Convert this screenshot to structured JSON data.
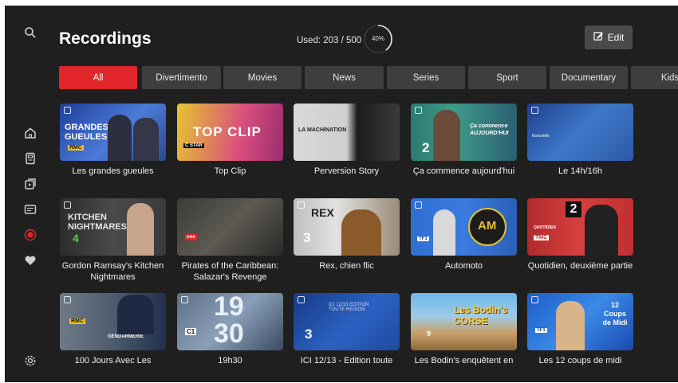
{
  "header": {
    "title": "Recordings",
    "used_text": "Used: 203 / 500",
    "usage_percent": 40,
    "usage_label": "40%",
    "edit_label": "Edit"
  },
  "tabs": [
    "All",
    "Divertimento",
    "Movies",
    "News",
    "Series",
    "Sport",
    "Documentary",
    "Kids"
  ],
  "recordings": [
    {
      "title": "Les grandes gueules",
      "thumb_text": "GRANDES GUEULES",
      "badge": "RMC"
    },
    {
      "title": "Top Clip",
      "thumb_text": "TOP CLIP",
      "badge": "C STAR"
    },
    {
      "title": "Perversion Story",
      "thumb_text": "LA MACHINATION",
      "badge": ""
    },
    {
      "title": "Ça commence aujourd'hui",
      "thumb_text": "Ça commence AUJOURD'HUI",
      "badge": "2"
    },
    {
      "title": "Le 14h/16h",
      "thumb_text": "franceinfo",
      "badge": ""
    },
    {
      "title": "Gordon Ramsay's Kitchen Nightmares",
      "thumb_text": "KITCHEN NIGHTMARES",
      "badge": "4"
    },
    {
      "title": "Pirates of the Caribbean: Salazar's Revenge",
      "thumb_text": "",
      "badge": "one"
    },
    {
      "title": "Rex, chien flic",
      "thumb_text": "REX",
      "badge": "3"
    },
    {
      "title": "Automoto",
      "thumb_text": "AM",
      "badge": "TF1"
    },
    {
      "title": "Quotidien, deuxième partie",
      "thumb_text": "QUOTIDIEN",
      "badge": "TMC"
    },
    {
      "title": "100 Jours Avec Les",
      "thumb_text": "GENDARMERIE",
      "badge": "RMC"
    },
    {
      "title": "19h30",
      "thumb_text": "19 30",
      "badge": "C1"
    },
    {
      "title": "ICI 12/13 - Edition toute",
      "thumb_text": "ICI 12/13 EDITION TOUTE REGION",
      "badge": "3"
    },
    {
      "title": "Les Bodin's enquêtent en",
      "thumb_text": "Les Bodin's CORSE",
      "badge": "9"
    },
    {
      "title": "Les 12 coups de midi",
      "thumb_text": "12 Coups de Midi",
      "badge": "TF1"
    }
  ],
  "colors": {
    "accent": "#e0262a",
    "background": "#1f1f1f",
    "tab": "#3e3e3e"
  }
}
